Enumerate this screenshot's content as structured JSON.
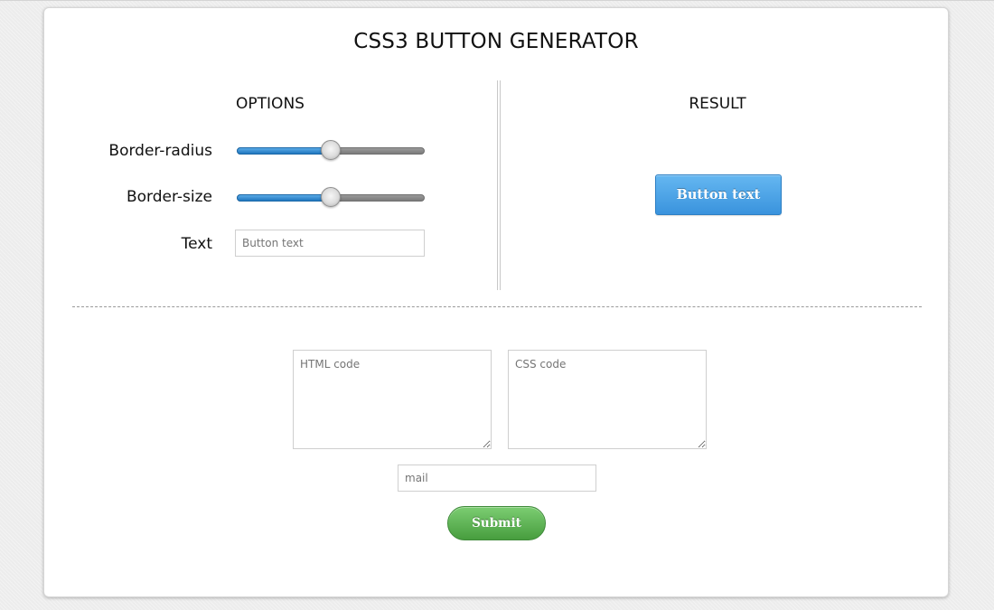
{
  "title": "CSS3 BUTTON GENERATOR",
  "options": {
    "heading": "OPTIONS",
    "border_radius": {
      "label": "Border-radius",
      "value_fraction": 0.5
    },
    "border_size": {
      "label": "Border-size",
      "value_fraction": 0.5
    },
    "text": {
      "label": "Text",
      "placeholder": "Button text"
    }
  },
  "result": {
    "heading": "RESULT",
    "button_label": "Button text"
  },
  "code": {
    "html_placeholder": "HTML code",
    "css_placeholder": "CSS code"
  },
  "form": {
    "mail_placeholder": "mail",
    "submit_label": "Submit"
  },
  "colors": {
    "preview_button": "#4aa3e6",
    "submit_button": "#5cb152",
    "slider_fill": "#2f86cf"
  }
}
